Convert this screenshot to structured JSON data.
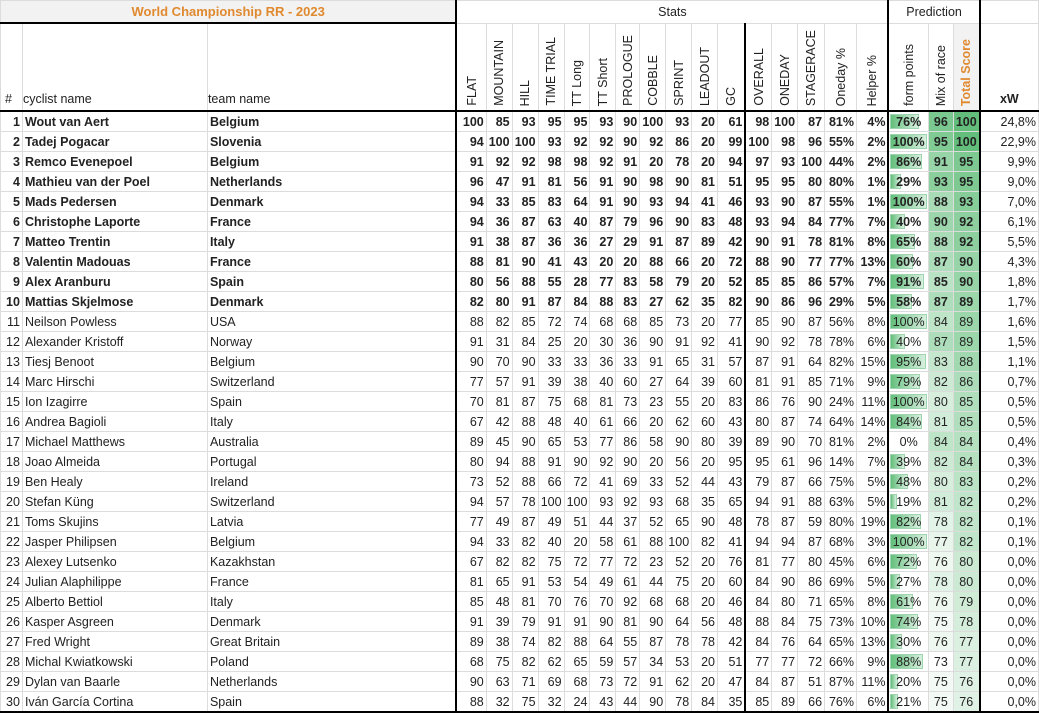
{
  "title": "World Championship RR - 2023",
  "groups": {
    "stats": "Stats",
    "prediction": "Prediction"
  },
  "headers": {
    "rank": "#",
    "name": "cyclist name",
    "team": "team name",
    "stats": [
      "FLAT",
      "MOUNTAIN",
      "HILL",
      "TIME TRIAL",
      "TT Long",
      "TT Short",
      "PROLOGUE",
      "COBBLE",
      "SPRINT",
      "LEADOUT",
      "GC"
    ],
    "ratings": [
      "OVERALL",
      "ONEDAY",
      "STAGERACE",
      "Oneday %",
      "Helper %"
    ],
    "prediction": [
      "form points",
      "Mix of race",
      "Total Score"
    ],
    "xw": "xW"
  },
  "colors": {
    "title": "#e0892f",
    "scale_high": "#63be7b",
    "scale_low": "#ffffff",
    "bar": "#63be7b"
  },
  "rows": [
    [
      "1",
      "Wout van Aert",
      "Belgium",
      "100",
      "85",
      "93",
      "95",
      "95",
      "93",
      "90",
      "100",
      "93",
      "20",
      "61",
      "98",
      "100",
      "87",
      "81%",
      "4%",
      "76%",
      "96",
      "100",
      "24,8%"
    ],
    [
      "2",
      "Tadej Pogacar",
      "Slovenia",
      "94",
      "100",
      "100",
      "93",
      "92",
      "92",
      "90",
      "92",
      "86",
      "20",
      "99",
      "100",
      "98",
      "96",
      "55%",
      "2%",
      "100%",
      "95",
      "100",
      "22,9%"
    ],
    [
      "3",
      "Remco Evenepoel",
      "Belgium",
      "91",
      "92",
      "92",
      "98",
      "98",
      "92",
      "91",
      "20",
      "78",
      "20",
      "94",
      "97",
      "93",
      "100",
      "44%",
      "2%",
      "86%",
      "91",
      "95",
      "9,9%"
    ],
    [
      "4",
      "Mathieu van der Poel",
      "Netherlands",
      "96",
      "47",
      "91",
      "81",
      "56",
      "91",
      "90",
      "98",
      "90",
      "81",
      "51",
      "95",
      "95",
      "80",
      "80%",
      "1%",
      "29%",
      "93",
      "95",
      "9,0%"
    ],
    [
      "5",
      "Mads Pedersen",
      "Denmark",
      "94",
      "33",
      "85",
      "83",
      "64",
      "91",
      "90",
      "93",
      "94",
      "41",
      "46",
      "93",
      "90",
      "87",
      "55%",
      "1%",
      "100%",
      "88",
      "93",
      "7,0%"
    ],
    [
      "6",
      "Christophe Laporte",
      "France",
      "94",
      "36",
      "87",
      "63",
      "40",
      "87",
      "79",
      "96",
      "90",
      "83",
      "48",
      "93",
      "94",
      "84",
      "77%",
      "7%",
      "40%",
      "90",
      "92",
      "6,1%"
    ],
    [
      "7",
      "Matteo Trentin",
      "Italy",
      "91",
      "38",
      "87",
      "36",
      "36",
      "27",
      "29",
      "91",
      "87",
      "89",
      "42",
      "90",
      "91",
      "78",
      "81%",
      "8%",
      "65%",
      "88",
      "92",
      "5,5%"
    ],
    [
      "8",
      "Valentin Madouas",
      "France",
      "88",
      "81",
      "90",
      "41",
      "43",
      "20",
      "20",
      "88",
      "66",
      "20",
      "72",
      "88",
      "90",
      "77",
      "77%",
      "13%",
      "60%",
      "87",
      "90",
      "4,3%"
    ],
    [
      "9",
      "Alex Aranburu",
      "Spain",
      "80",
      "56",
      "88",
      "55",
      "28",
      "77",
      "83",
      "58",
      "79",
      "20",
      "52",
      "85",
      "85",
      "86",
      "57%",
      "7%",
      "91%",
      "85",
      "90",
      "1,8%"
    ],
    [
      "10",
      "Mattias Skjelmose",
      "Denmark",
      "82",
      "80",
      "91",
      "87",
      "84",
      "88",
      "83",
      "27",
      "62",
      "35",
      "82",
      "90",
      "86",
      "96",
      "29%",
      "5%",
      "58%",
      "87",
      "89",
      "1,7%"
    ],
    [
      "11",
      "Neilson Powless",
      "USA",
      "88",
      "82",
      "85",
      "72",
      "74",
      "68",
      "68",
      "85",
      "73",
      "20",
      "77",
      "85",
      "90",
      "87",
      "56%",
      "8%",
      "100%",
      "84",
      "89",
      "1,6%"
    ],
    [
      "12",
      "Alexander Kristoff",
      "Norway",
      "91",
      "31",
      "84",
      "25",
      "20",
      "30",
      "36",
      "90",
      "91",
      "92",
      "41",
      "90",
      "92",
      "78",
      "78%",
      "6%",
      "40%",
      "87",
      "89",
      "1,5%"
    ],
    [
      "13",
      "Tiesj Benoot",
      "Belgium",
      "90",
      "70",
      "90",
      "33",
      "33",
      "36",
      "33",
      "91",
      "65",
      "31",
      "57",
      "87",
      "91",
      "64",
      "82%",
      "15%",
      "95%",
      "83",
      "88",
      "1,1%"
    ],
    [
      "14",
      "Marc Hirschi",
      "Switzerland",
      "77",
      "57",
      "91",
      "39",
      "38",
      "40",
      "60",
      "27",
      "64",
      "39",
      "60",
      "81",
      "91",
      "85",
      "71%",
      "9%",
      "79%",
      "82",
      "86",
      "0,7%"
    ],
    [
      "15",
      "Ion Izagirre",
      "Spain",
      "70",
      "81",
      "87",
      "75",
      "68",
      "81",
      "73",
      "23",
      "55",
      "20",
      "83",
      "86",
      "76",
      "90",
      "24%",
      "11%",
      "100%",
      "80",
      "85",
      "0,5%"
    ],
    [
      "16",
      "Andrea Bagioli",
      "Italy",
      "67",
      "42",
      "88",
      "48",
      "40",
      "61",
      "66",
      "20",
      "62",
      "60",
      "43",
      "80",
      "87",
      "74",
      "64%",
      "14%",
      "84%",
      "81",
      "85",
      "0,5%"
    ],
    [
      "17",
      "Michael Matthews",
      "Australia",
      "89",
      "45",
      "90",
      "65",
      "53",
      "77",
      "86",
      "58",
      "90",
      "80",
      "39",
      "89",
      "90",
      "70",
      "81%",
      "2%",
      "0%",
      "84",
      "84",
      "0,4%"
    ],
    [
      "18",
      "Joao Almeida",
      "Portugal",
      "80",
      "94",
      "88",
      "91",
      "90",
      "92",
      "90",
      "20",
      "56",
      "20",
      "95",
      "95",
      "61",
      "96",
      "14%",
      "7%",
      "39%",
      "82",
      "84",
      "0,3%"
    ],
    [
      "19",
      "Ben Healy",
      "Ireland",
      "73",
      "52",
      "88",
      "66",
      "72",
      "41",
      "69",
      "33",
      "52",
      "44",
      "43",
      "79",
      "87",
      "66",
      "75%",
      "5%",
      "48%",
      "80",
      "83",
      "0,2%"
    ],
    [
      "20",
      "Stefan Küng",
      "Switzerland",
      "94",
      "57",
      "78",
      "100",
      "100",
      "93",
      "92",
      "93",
      "68",
      "35",
      "65",
      "94",
      "91",
      "88",
      "63%",
      "5%",
      "19%",
      "81",
      "82",
      "0,2%"
    ],
    [
      "21",
      "Toms Skujins",
      "Latvia",
      "77",
      "49",
      "87",
      "49",
      "51",
      "44",
      "37",
      "52",
      "65",
      "90",
      "48",
      "78",
      "87",
      "59",
      "80%",
      "19%",
      "82%",
      "78",
      "82",
      "0,1%"
    ],
    [
      "22",
      "Jasper Philipsen",
      "Belgium",
      "94",
      "33",
      "82",
      "40",
      "20",
      "58",
      "61",
      "88",
      "100",
      "82",
      "41",
      "94",
      "94",
      "87",
      "68%",
      "3%",
      "100%",
      "77",
      "82",
      "0,1%"
    ],
    [
      "23",
      "Alexey Lutsenko",
      "Kazakhstan",
      "67",
      "82",
      "82",
      "75",
      "72",
      "77",
      "72",
      "23",
      "52",
      "20",
      "76",
      "81",
      "77",
      "80",
      "45%",
      "6%",
      "72%",
      "76",
      "80",
      "0,0%"
    ],
    [
      "24",
      "Julian Alaphilippe",
      "France",
      "81",
      "65",
      "91",
      "53",
      "54",
      "49",
      "61",
      "44",
      "75",
      "20",
      "60",
      "84",
      "90",
      "86",
      "69%",
      "5%",
      "27%",
      "78",
      "80",
      "0,0%"
    ],
    [
      "25",
      "Alberto Bettiol",
      "Italy",
      "85",
      "48",
      "81",
      "70",
      "76",
      "70",
      "92",
      "68",
      "68",
      "20",
      "46",
      "84",
      "80",
      "71",
      "65%",
      "8%",
      "61%",
      "76",
      "79",
      "0,0%"
    ],
    [
      "26",
      "Kasper Asgreen",
      "Denmark",
      "91",
      "39",
      "79",
      "91",
      "91",
      "90",
      "81",
      "90",
      "64",
      "56",
      "48",
      "88",
      "84",
      "75",
      "73%",
      "10%",
      "74%",
      "75",
      "78",
      "0,0%"
    ],
    [
      "27",
      "Fred Wright",
      "Great Britain",
      "89",
      "38",
      "74",
      "82",
      "88",
      "64",
      "55",
      "87",
      "78",
      "78",
      "42",
      "84",
      "76",
      "64",
      "65%",
      "13%",
      "30%",
      "76",
      "77",
      "0,0%"
    ],
    [
      "28",
      "Michal Kwiatkowski",
      "Poland",
      "68",
      "75",
      "82",
      "62",
      "65",
      "59",
      "57",
      "34",
      "53",
      "20",
      "51",
      "77",
      "77",
      "72",
      "66%",
      "9%",
      "88%",
      "73",
      "77",
      "0,0%"
    ],
    [
      "29",
      "Dylan van Baarle",
      "Netherlands",
      "90",
      "63",
      "71",
      "69",
      "68",
      "73",
      "72",
      "91",
      "62",
      "20",
      "47",
      "84",
      "87",
      "51",
      "87%",
      "11%",
      "20%",
      "75",
      "76",
      "0,0%"
    ],
    [
      "30",
      "Iván García Cortina",
      "Spain",
      "88",
      "32",
      "75",
      "32",
      "24",
      "43",
      "44",
      "90",
      "78",
      "84",
      "35",
      "85",
      "89",
      "66",
      "76%",
      "6%",
      "21%",
      "75",
      "76",
      "0,0%"
    ]
  ]
}
